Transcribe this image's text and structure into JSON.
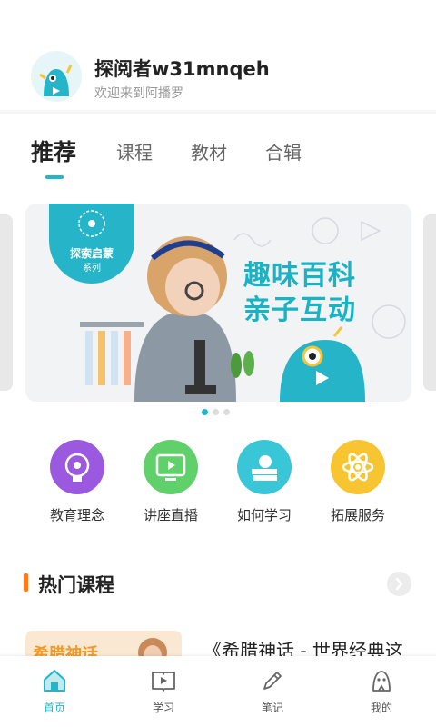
{
  "profile": {
    "username": "探阅者w31mnqeh",
    "welcome": "欢迎来到阿播罗"
  },
  "tabs": [
    {
      "label": "推荐",
      "active": true
    },
    {
      "label": "课程",
      "active": false
    },
    {
      "label": "教材",
      "active": false
    },
    {
      "label": "合辑",
      "active": false
    }
  ],
  "banner": {
    "badge_line1": "探索启蒙",
    "badge_line2": "系列",
    "title_line1": "趣味百科",
    "title_line2": "亲子互动",
    "page_count": 3,
    "current_page": 1
  },
  "quick_entries": [
    {
      "label": "教育理念",
      "icon": "lightbulb-gear-icon",
      "color": "#9b59e0"
    },
    {
      "label": "讲座直播",
      "icon": "live-screen-icon",
      "color": "#5fd06a"
    },
    {
      "label": "如何学习",
      "icon": "books-apple-icon",
      "color": "#39c6d6"
    },
    {
      "label": "拓展服务",
      "icon": "atom-icon",
      "color": "#f7c531"
    }
  ],
  "section": {
    "title": "热门课程"
  },
  "course": {
    "thumb_text": "希腊神话",
    "title": "《希腊神话 - 世界经典这"
  },
  "bottom_nav": [
    {
      "label": "首页",
      "icon": "home-icon",
      "active": true
    },
    {
      "label": "学习",
      "icon": "book-play-icon",
      "active": false
    },
    {
      "label": "笔记",
      "icon": "pencil-icon",
      "active": false
    },
    {
      "label": "我的",
      "icon": "profile-icon",
      "active": false
    }
  ],
  "colors": {
    "accent": "#26b5c8",
    "section_marker": "#ff7a1a"
  }
}
